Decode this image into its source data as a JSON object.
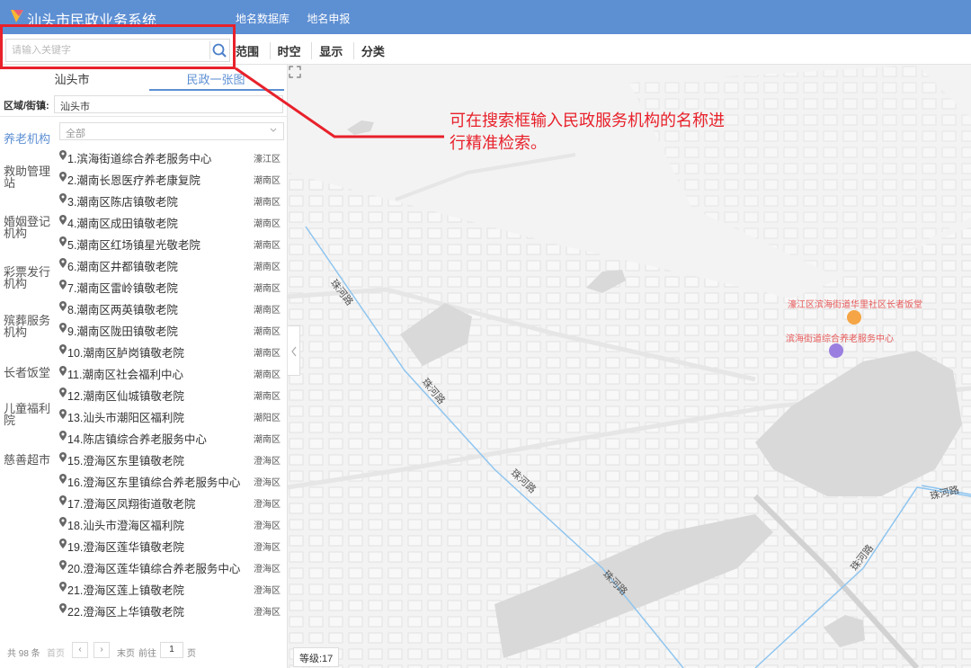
{
  "header": {
    "app_title": "汕头市民政业务系统",
    "nav": [
      "地名数据库",
      "地名申报"
    ]
  },
  "toolbar": {
    "search_placeholder": "请输入关键字",
    "tools": [
      "范围",
      "时空",
      "显示",
      "分类"
    ]
  },
  "annotation": {
    "callout_text": "可在搜索框输入民政服务机构的名称进行精准检索。"
  },
  "panel": {
    "tabs": [
      "汕头市",
      "民政一张图"
    ],
    "region_label": "区域/街镇:",
    "region_value": "汕头市",
    "categories": [
      "养老机构",
      "救助管理站",
      "婚姻登记机构",
      "彩票发行机构",
      "殡葬服务机构",
      "长者饭堂",
      "儿童福利院",
      "慈善超市"
    ],
    "filter_value": "全部",
    "items": [
      {
        "name": "1.滨海街道综合养老服务中心",
        "district": "濠江区"
      },
      {
        "name": "2.潮南长恩医疗养老康复院",
        "district": "潮南区"
      },
      {
        "name": "3.潮南区陈店镇敬老院",
        "district": "潮南区"
      },
      {
        "name": "4.潮南区成田镇敬老院",
        "district": "潮南区"
      },
      {
        "name": "5.潮南区红场镇星光敬老院",
        "district": "潮南区"
      },
      {
        "name": "6.潮南区井都镇敬老院",
        "district": "潮南区"
      },
      {
        "name": "7.潮南区雷岭镇敬老院",
        "district": "潮南区"
      },
      {
        "name": "8.潮南区两英镇敬老院",
        "district": "潮南区"
      },
      {
        "name": "9.潮南区陇田镇敬老院",
        "district": "潮南区"
      },
      {
        "name": "10.潮南区胪岗镇敬老院",
        "district": "潮南区"
      },
      {
        "name": "11.潮南区社会福利中心",
        "district": "潮南区"
      },
      {
        "name": "12.潮南区仙城镇敬老院",
        "district": "潮南区"
      },
      {
        "name": "13.汕头市潮阳区福利院",
        "district": "潮阳区"
      },
      {
        "name": "14.陈店镇综合养老服务中心",
        "district": "潮南区"
      },
      {
        "name": "15.澄海区东里镇敬老院",
        "district": "澄海区"
      },
      {
        "name": "16.澄海区东里镇综合养老服务中心",
        "district": "澄海区"
      },
      {
        "name": "17.澄海区凤翔街道敬老院",
        "district": "澄海区"
      },
      {
        "name": "18.汕头市澄海区福利院",
        "district": "澄海区"
      },
      {
        "name": "19.澄海区莲华镇敬老院",
        "district": "澄海区"
      },
      {
        "name": "20.澄海区莲华镇综合养老服务中心",
        "district": "澄海区"
      },
      {
        "name": "21.澄海区莲上镇敬老院",
        "district": "澄海区"
      },
      {
        "name": "22.澄海区上华镇敬老院",
        "district": "澄海区"
      }
    ],
    "pager": {
      "total": "共 98 条",
      "first": "首页",
      "prev": "‹",
      "next": "›",
      "last": "末页",
      "goto": "前往",
      "page": "1",
      "page_unit": "页"
    }
  },
  "map": {
    "zoom_label": "等级:17",
    "road_name": "珠河路",
    "poi_1": "濠江区滨海街道华里社区长者饭堂",
    "poi_2": "滨海街道综合养老服务中心"
  },
  "colors": {
    "header_bg": "#5d8fd3",
    "accent": "#5d8fd3",
    "annotation": "#e8212b"
  }
}
